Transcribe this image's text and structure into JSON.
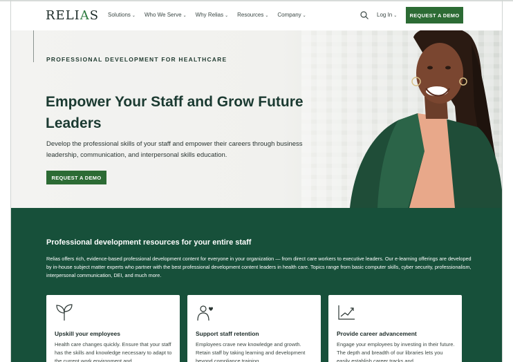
{
  "header": {
    "logo": {
      "pre": "RELI",
      "accent": "A",
      "post": "S"
    },
    "nav": [
      {
        "label": "Solutions"
      },
      {
        "label": "Who We Serve"
      },
      {
        "label": "Why Relias"
      },
      {
        "label": "Resources"
      },
      {
        "label": "Company"
      }
    ],
    "login_label": "Log In",
    "cta_label": "REQUEST A DEMO"
  },
  "hero": {
    "eyebrow": "PROFESSIONAL DEVELOPMENT FOR HEALTHCARE",
    "title": "Empower Your Staff and Grow Future Leaders",
    "lead": "Develop the professional skills of your staff and empower their careers through business leadership, communication, and interpersonal skills education.",
    "cta_label": "REQUEST A DEMO"
  },
  "resources": {
    "title": "Professional development resources for your entire staff",
    "body": "Relias offers rich, evidence-based professional development content for everyone in your organization — from direct care workers to executive leaders. Our e-learning offerings are developed by in-house subject matter experts who partner with the best professional development content leaders in health care. Topics range from basic computer skills, cyber security, professionalism, interpersonal communication, DEI, and much more.",
    "cards": [
      {
        "icon": "sprout-icon",
        "title": "Upskill your employees",
        "text": "Health care changes quickly. Ensure that your staff has the skills and knowledge necessary to adapt to the current work environment and"
      },
      {
        "icon": "person-heart-icon",
        "title": "Support staff retention",
        "text": "Employees crave new knowledge and growth. Retain staff by taking learning and development beyond compliance training"
      },
      {
        "icon": "growth-chart-icon",
        "title": "Provide career advancement",
        "text": "Engage your employees by investing in their future. The depth and breadth of our libraries lets you easily establish career tracks and"
      }
    ]
  },
  "colors": {
    "brand_green": "#2c6b34",
    "section_green": "#17503a",
    "heading_dark": "#1b3a31"
  }
}
